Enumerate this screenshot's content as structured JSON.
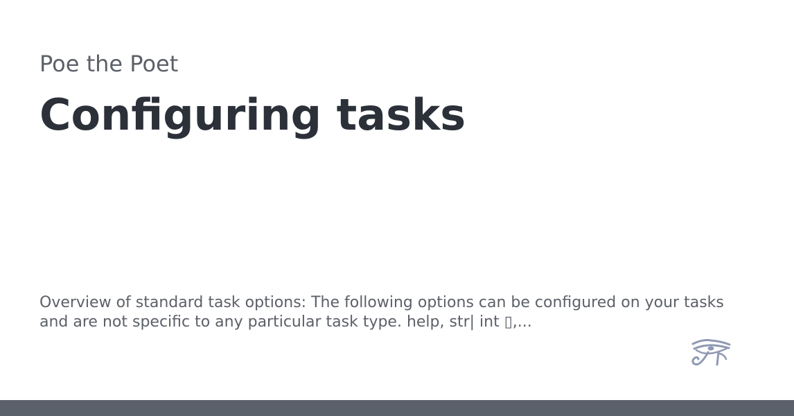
{
  "site": {
    "name": "Poe the Poet"
  },
  "page": {
    "title": "Configuring tasks",
    "description": "Overview of standard task options: The following options can be configured on your tasks and are not specific to any particular task type. help, str| int ▯,..."
  },
  "logo": {
    "icon": "eye-of-horus-icon",
    "color": "#8f99b3"
  },
  "colors": {
    "background": "#ffffff",
    "site_name": "#5c6068",
    "title": "#2b3039",
    "description": "#5c6068",
    "footer_bar": "#5b616b"
  }
}
